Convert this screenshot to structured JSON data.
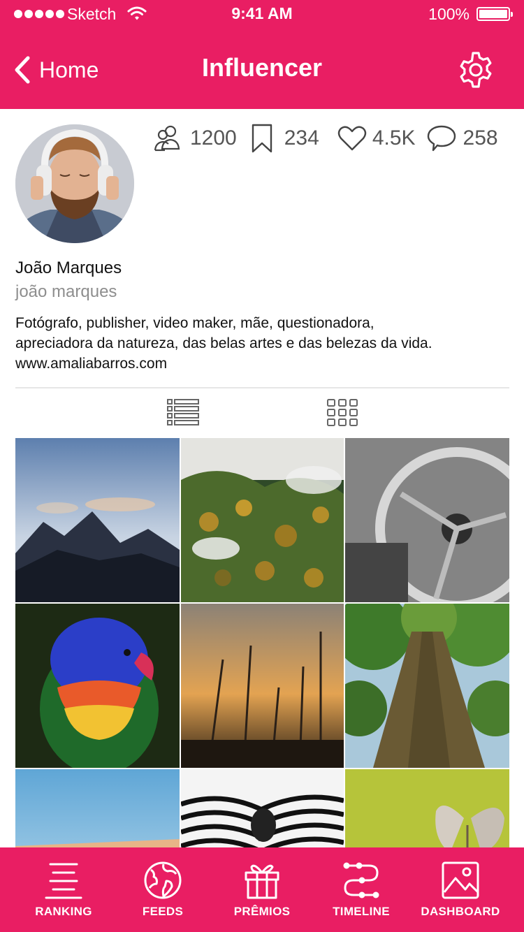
{
  "status_bar": {
    "carrier": "Sketch",
    "time": "9:41 AM",
    "battery": "100%"
  },
  "nav": {
    "back_label": "Home",
    "title": "Influencer"
  },
  "profile": {
    "stats": [
      {
        "icon": "followers-icon",
        "value": "1200"
      },
      {
        "icon": "bookmark-icon",
        "value": "234"
      },
      {
        "icon": "heart-icon",
        "value": "4.5K"
      },
      {
        "icon": "comment-icon",
        "value": "258"
      }
    ],
    "name": "João Marques",
    "handle": "joão marques",
    "bio_lines": [
      "Fotógrafo, publisher, video maker, mãe, questionadora,",
      "apreciadora da natureza, das belas artes e das belezas da vida.",
      "www.amaliabarros.com"
    ]
  },
  "gallery": {
    "view_modes": [
      "list-view-icon",
      "grid-view-icon"
    ],
    "photos": [
      "mountain",
      "foggy-forest",
      "steering-wheel",
      "parrot",
      "wheat-sunset",
      "tree-trunk",
      "beach",
      "zebras",
      "butterfly"
    ]
  },
  "tabbar": {
    "tabs": [
      {
        "icon": "ranking-icon",
        "label": "RANKING"
      },
      {
        "icon": "feeds-icon",
        "label": "FEEDS"
      },
      {
        "icon": "gift-icon",
        "label": "PRÊMIOS"
      },
      {
        "icon": "timeline-icon",
        "label": "TIMELINE"
      },
      {
        "icon": "image-icon",
        "label": "DASHBOARD"
      }
    ]
  },
  "colors": {
    "accent": "#e91e63",
    "text": "#111111",
    "muted": "#8e8e8e",
    "stat_text": "#555555"
  }
}
